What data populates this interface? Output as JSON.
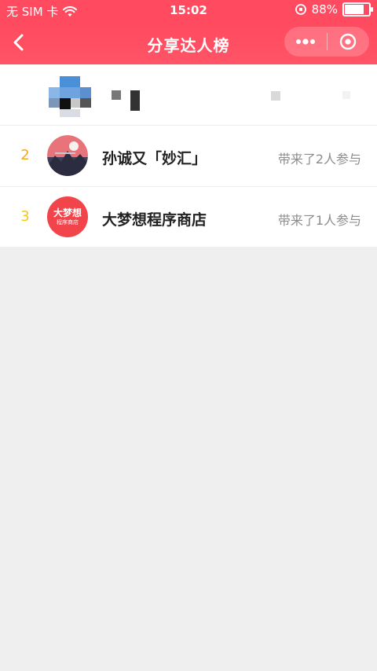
{
  "status": {
    "carrier": "无 SIM 卡",
    "time": "15:02",
    "battery": "88%"
  },
  "nav": {
    "title": "分享达人榜"
  },
  "list": {
    "items": [
      {
        "rank": "2",
        "name": "孙诚又「妙汇」",
        "meta": "带来了2人参与"
      },
      {
        "rank": "3",
        "name": "大梦想程序商店",
        "meta": "带来了1人参与",
        "logo_line1": "大梦想",
        "logo_line2": "程序商店"
      }
    ]
  },
  "colors": {
    "primary": "#ff4a5f",
    "rank2": "#f5a623",
    "rank3": "#f8c51c",
    "meta": "#8c8c8c"
  }
}
